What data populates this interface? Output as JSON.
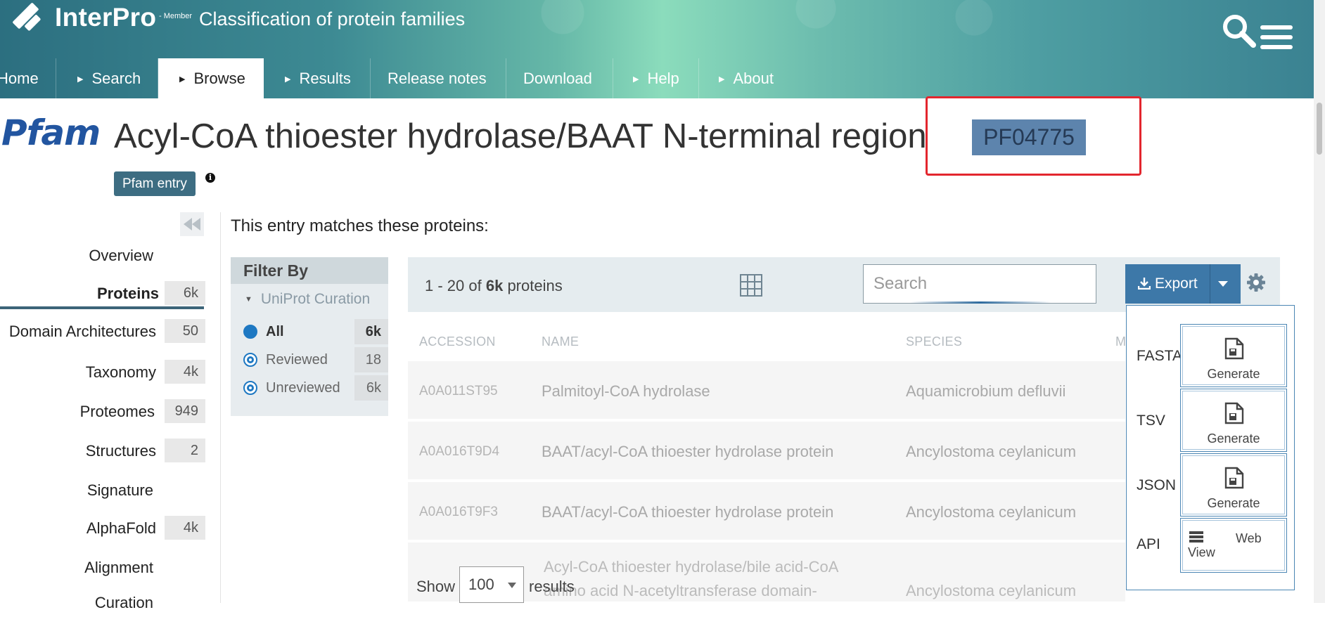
{
  "header": {
    "brand": "InterPro",
    "member_tag": "- Member",
    "subtitle": "Classification of protein families",
    "tabs": [
      {
        "label": "Home",
        "arrow": false
      },
      {
        "label": "Search",
        "arrow": true
      },
      {
        "label": "Browse",
        "arrow": true,
        "active": true
      },
      {
        "label": "Results",
        "arrow": true
      },
      {
        "label": "Release notes",
        "arrow": false
      },
      {
        "label": "Download",
        "arrow": false
      },
      {
        "label": "Help",
        "arrow": true
      },
      {
        "label": "About",
        "arrow": true
      }
    ]
  },
  "entry": {
    "database_logo": "Pfam",
    "title": "Acyl-CoA thioester hydrolase/BAAT N-terminal region",
    "accession": "PF04775",
    "type_badge": "Pfam entry",
    "info_icon": "i",
    "highlight_color": "#e3262e"
  },
  "sidebar": {
    "items": [
      {
        "label": "Overview",
        "count": ""
      },
      {
        "label": "Proteins",
        "count": "6k",
        "active": true
      },
      {
        "label": "Domain Architectures",
        "count": "50"
      },
      {
        "label": "Taxonomy",
        "count": "4k"
      },
      {
        "label": "Proteomes",
        "count": "949"
      },
      {
        "label": "Structures",
        "count": "2"
      },
      {
        "label": "Signature",
        "count": ""
      },
      {
        "label": "AlphaFold",
        "count": "4k"
      },
      {
        "label": "Alignment",
        "count": ""
      },
      {
        "label": "Curation",
        "count": ""
      }
    ]
  },
  "main": {
    "heading": "This entry matches these proteins:",
    "filter": {
      "title": "Filter By",
      "group": "UniProt Curation",
      "options": [
        {
          "label": "All",
          "count": "6k",
          "selected": true
        },
        {
          "label": "Reviewed",
          "count": "18",
          "selected": false
        },
        {
          "label": "Unreviewed",
          "count": "6k",
          "selected": false
        }
      ]
    },
    "table": {
      "range_prefix": "1 - 20 of ",
      "range_total": "6k",
      "range_suffix": " proteins",
      "search_placeholder": "Search",
      "export_label": "Export",
      "columns": [
        "ACCESSION",
        "NAME",
        "SPECIES",
        "M"
      ],
      "rows": [
        {
          "accession": "A0A011ST95",
          "name": "Palmitoyl-CoA hydrolase",
          "species": "Aquamicrobium defluvii"
        },
        {
          "accession": "A0A016T9D4",
          "name": "BAAT/acyl-CoA thioester hydrolase protein",
          "species": "Ancylostoma ceylanicum"
        },
        {
          "accession": "A0A016T9F3",
          "name": "BAAT/acyl-CoA thioester hydrolase protein",
          "species": "Ancylostoma ceylanicum"
        },
        {
          "accession": "",
          "name": "Acyl-CoA thioester hydrolase/bile acid-CoA amino acid N-acetyltransferase domain-",
          "species": "Ancylostoma ceylanicum"
        }
      ],
      "show_label": "Show",
      "page_size": "100",
      "results_label": "results"
    },
    "export_menu": {
      "items": [
        {
          "format": "FASTA",
          "action": "Generate"
        },
        {
          "format": "TSV",
          "action": "Generate"
        },
        {
          "format": "JSON",
          "action": "Generate"
        }
      ],
      "api_label": "API",
      "api_web": "Web",
      "api_view": "View"
    }
  },
  "colors": {
    "accent": "#3d78a8",
    "badge": "#5d84ad",
    "entry_badge": "#3d6d82",
    "radio": "#1e78c2"
  }
}
